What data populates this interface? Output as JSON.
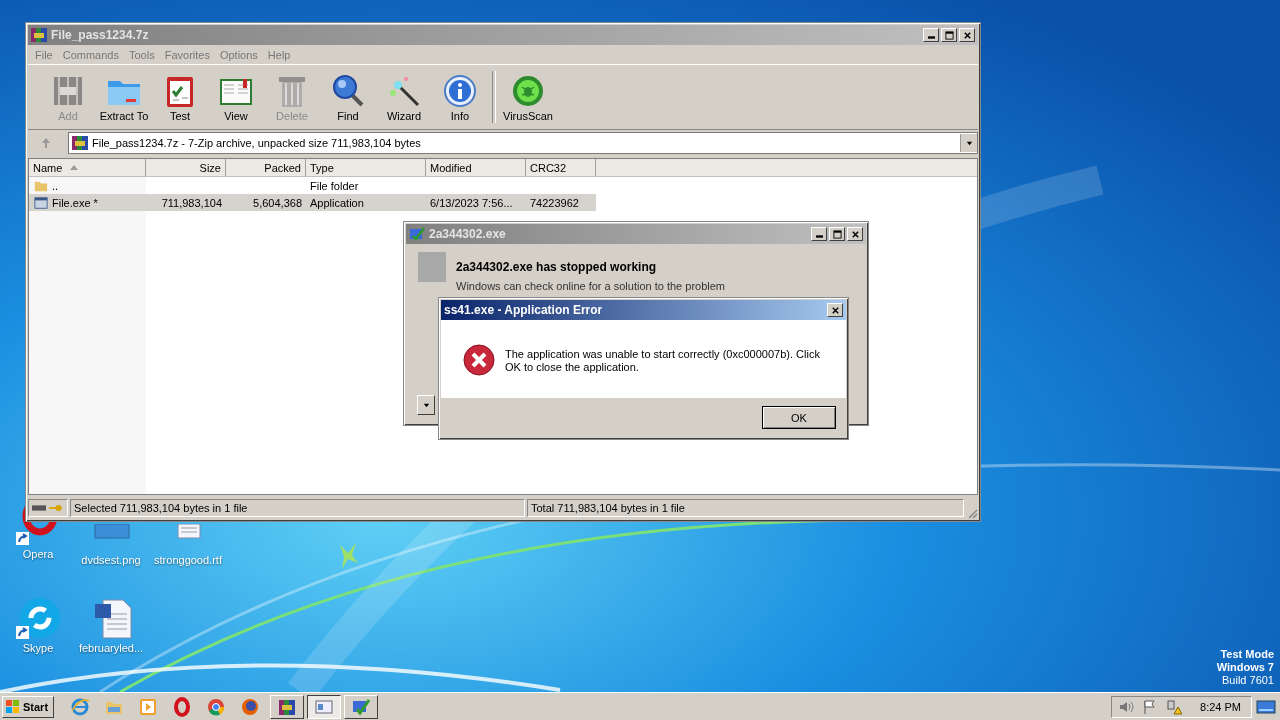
{
  "desktop": {
    "icons": [
      {
        "label": "Opera",
        "kind": "opera",
        "shortcut": true
      },
      {
        "label": "dvdsest.png",
        "kind": "image"
      },
      {
        "label": "stronggood.rtf",
        "kind": "document"
      },
      {
        "label": "Skype",
        "kind": "skype",
        "shortcut": true
      },
      {
        "label": "februaryled...",
        "kind": "word",
        "shortcut": false
      }
    ],
    "build_info": [
      "Test Mode",
      "Windows 7",
      "Build 7601"
    ]
  },
  "archive_window": {
    "title": "File_pass1234.7z",
    "menu": [
      "File",
      "Commands",
      "Tools",
      "Favorites",
      "Options",
      "Help"
    ],
    "toolbar": [
      {
        "label": "Add",
        "kind": "add",
        "disabled": true
      },
      {
        "label": "Extract To",
        "kind": "extract",
        "disabled": false
      },
      {
        "label": "Test",
        "kind": "test",
        "disabled": false
      },
      {
        "label": "View",
        "kind": "view",
        "disabled": false
      },
      {
        "label": "Delete",
        "kind": "delete",
        "disabled": true
      },
      {
        "label": "Find",
        "kind": "find",
        "disabled": false
      },
      {
        "label": "Wizard",
        "kind": "wizard",
        "disabled": false
      },
      {
        "label": "Info",
        "kind": "info",
        "disabled": false
      },
      {
        "label": "VirusScan",
        "kind": "virusscan",
        "disabled": false
      }
    ],
    "address": "File_pass1234.7z - 7-Zip archive, unpacked size 711,983,104 bytes",
    "columns": [
      {
        "label": "Name",
        "sorted": true
      },
      {
        "label": "Size",
        "sorted": false
      },
      {
        "label": "Packed",
        "sorted": false
      },
      {
        "label": "Type",
        "sorted": false
      },
      {
        "label": "Modified",
        "sorted": false
      },
      {
        "label": "CRC32",
        "sorted": false
      }
    ],
    "rows": [
      {
        "kind": "folder",
        "selected": false,
        "cells": [
          "..",
          "",
          "",
          "File folder",
          "",
          ""
        ]
      },
      {
        "kind": "exe",
        "selected": true,
        "cells": [
          "File.exe *",
          "711,983,104",
          "5,604,368",
          "Application",
          "6/13/2023 7:56...",
          "74223962"
        ]
      }
    ],
    "status_left": "Selected 711,983,104 bytes in 1 file",
    "status_right": "Total 711,983,104 bytes in 1 file"
  },
  "crash_dialog": {
    "title": "2a344302.exe",
    "heading": "2a344302.exe has stopped working",
    "message": "Windows can check online for a solution to the problem"
  },
  "error_dialog": {
    "title": "ss41.exe - Application Error",
    "message": "The application was unable to start correctly (0xc000007b). Click OK to close the application.",
    "button": "OK"
  },
  "taskbar": {
    "start": "Start",
    "pinned": [
      {
        "kind": "ie"
      },
      {
        "kind": "explorer"
      },
      {
        "kind": "media"
      },
      {
        "kind": "opera"
      },
      {
        "kind": "chrome"
      },
      {
        "kind": "firefox"
      }
    ],
    "windows": [
      {
        "kind": "archiver",
        "selected": false
      },
      {
        "kind": "window",
        "selected": true
      },
      {
        "kind": "crash",
        "selected": false
      }
    ],
    "clock": "8:24 PM"
  }
}
